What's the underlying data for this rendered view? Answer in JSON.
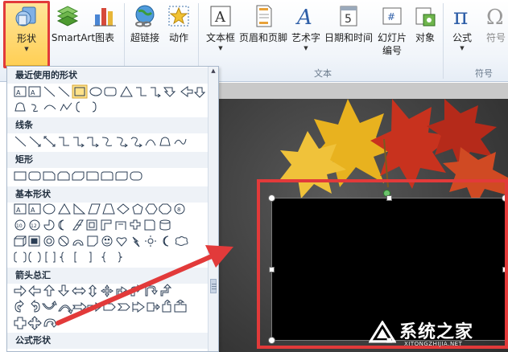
{
  "ribbon": {
    "buttons": {
      "shapes": "形状",
      "smartart": "SmartArt",
      "chart": "图表",
      "hyperlink": "超链接",
      "action": "动作",
      "textbox": "文本框",
      "header_footer": "页眉和页脚",
      "wordart": "艺术字",
      "datetime": "日期和时间",
      "slide_number_line1": "幻灯片",
      "slide_number_line2": "编号",
      "object": "对象",
      "formula": "公式",
      "symbol": "符号"
    },
    "groups": {
      "text": "文本",
      "symbols": "符号"
    }
  },
  "shapes_gallery": {
    "sections": [
      {
        "title": "最近使用的形状"
      },
      {
        "title": "线条"
      },
      {
        "title": "矩形"
      },
      {
        "title": "基本形状"
      },
      {
        "title": "箭头总汇"
      },
      {
        "title": "公式形状"
      }
    ]
  },
  "watermark": {
    "text": "系统之家",
    "url": "XITONGZHIJIA.NET"
  },
  "colors": {
    "highlight_red": "#e23a3a",
    "ribbon_active": "#ffcf55",
    "gallery_header": "#eef2f7",
    "slide_bg": "#3a3a3a",
    "rotation_handle": "#6cc36c"
  },
  "icons": {
    "shapes_button": "shapes-icon",
    "smartart_button": "smartart-icon",
    "chart_button": "chart-icon",
    "hyperlink_button": "globe-link-icon",
    "action_button": "star-action-icon",
    "textbox_button": "textbox-icon",
    "header_footer_button": "header-footer-icon",
    "wordart_button": "wordart-icon",
    "datetime_button": "calendar-icon",
    "slide_number_button": "slide-number-icon",
    "object_button": "object-icon",
    "formula_button": "pi-icon",
    "symbol_button": "omega-icon"
  }
}
